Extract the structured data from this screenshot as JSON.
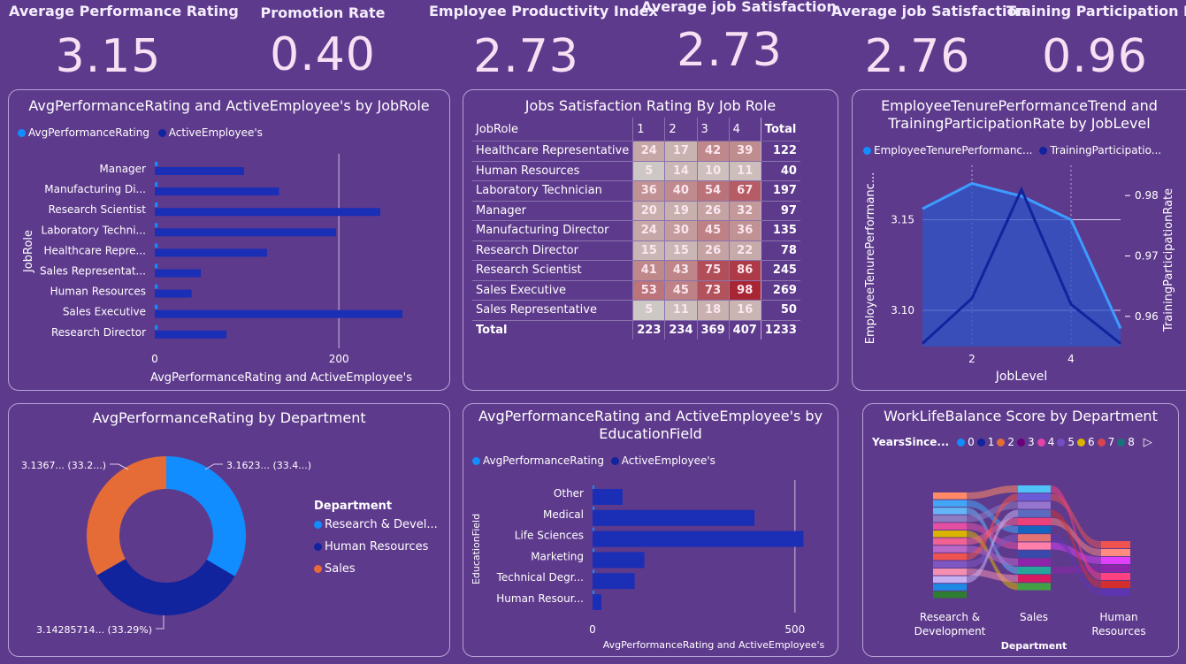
{
  "kpis": [
    {
      "label": "Average Performance Rating",
      "value": "3.15"
    },
    {
      "label": "Promotion Rate",
      "value": "0.40"
    },
    {
      "label": "Employee Productivity Index",
      "value": "2.73"
    },
    {
      "label": "Average job Satisfaction",
      "value": "2.73"
    },
    {
      "label": "Average job Satisfaction",
      "value": "2.76"
    },
    {
      "label": "Training Participation Ratio",
      "value": "0.96"
    }
  ],
  "colors": {
    "background": "#5e3a8c",
    "series_light": "#118dff",
    "series_dark": "#12239e",
    "orange": "#e66c37"
  },
  "jobrole_chart": {
    "title": "AvgPerformanceRating and ActiveEmployee's by JobRole",
    "legend": [
      "AvgPerformanceRating",
      "ActiveEmployee's"
    ],
    "ylabel": "JobRole",
    "xlabel": "AvgPerformanceRating and ActiveEmployee's",
    "ticks": [
      "0",
      "200"
    ]
  },
  "matrix": {
    "title": "Jobs Satisfaction Rating By Job Role",
    "headers": [
      "JobRole",
      "1",
      "2",
      "3",
      "4",
      "Total"
    ],
    "rows": [
      {
        "role": "Healthcare Representative",
        "v": [
          "24",
          "17",
          "42",
          "39"
        ],
        "total": "122"
      },
      {
        "role": "Human Resources",
        "v": [
          "5",
          "14",
          "10",
          "11"
        ],
        "total": "40"
      },
      {
        "role": "Laboratory Technician",
        "v": [
          "36",
          "40",
          "54",
          "67"
        ],
        "total": "197"
      },
      {
        "role": "Manager",
        "v": [
          "20",
          "19",
          "26",
          "32"
        ],
        "total": "97"
      },
      {
        "role": "Manufacturing Director",
        "v": [
          "24",
          "30",
          "45",
          "36"
        ],
        "total": "135"
      },
      {
        "role": "Research Director",
        "v": [
          "15",
          "15",
          "26",
          "22"
        ],
        "total": "78"
      },
      {
        "role": "Research Scientist",
        "v": [
          "41",
          "43",
          "75",
          "86"
        ],
        "total": "245"
      },
      {
        "role": "Sales Executive",
        "v": [
          "53",
          "45",
          "73",
          "98"
        ],
        "total": "269"
      },
      {
        "role": "Sales Representative",
        "v": [
          "5",
          "11",
          "18",
          "16"
        ],
        "total": "50"
      }
    ],
    "total_row": {
      "role": "Total",
      "v": [
        "223",
        "234",
        "369",
        "407"
      ],
      "total": "1233"
    }
  },
  "tenure_chart": {
    "title_line1": "EmployeeTenurePerformanceTrend and",
    "title_line2": "TrainingParticipationRate by JobLevel",
    "legend": [
      "EmployeeTenurePerformanc...",
      "TrainingParticipatio..."
    ],
    "ylabel_left": "EmployeeTenurePerformanc...",
    "ylabel_right": "TrainingParticipationRate",
    "xlabel": "JobLevel",
    "left_ticks": [
      "3.15",
      "3.10"
    ],
    "right_ticks": [
      "0.98",
      "0.97",
      "0.96"
    ],
    "x_ticks": [
      "2",
      "4"
    ]
  },
  "donut": {
    "title": "AvgPerformanceRating by Department",
    "legend_title": "Department",
    "labels": [
      "3.1367... (33.2...)",
      "3.1623... (33.4...)",
      "3.14285714... (33.29%)"
    ],
    "legend": [
      "Research & Devel...",
      "Human Resources",
      "Sales"
    ]
  },
  "edu_chart": {
    "title_line1": "AvgPerformanceRating and ActiveEmployee's by",
    "title_line2": "EducationField",
    "legend": [
      "AvgPerformanceRating",
      "ActiveEmployee's"
    ],
    "ylabel": "EducationField",
    "xlabel": "AvgPerformanceRating and ActiveEmployee's",
    "ticks": [
      "0",
      "500"
    ]
  },
  "wlb_chart": {
    "title": "WorkLifeBalance Score by Department",
    "legend_title": "YearsSince...",
    "legend": [
      "0",
      "1",
      "2",
      "3",
      "4",
      "5",
      "6",
      "7",
      "8"
    ],
    "legend_colors": [
      "#118dff",
      "#12239e",
      "#e66c37",
      "#6b007b",
      "#e044a7",
      "#744ec2",
      "#d9b300",
      "#d64550",
      "#197278"
    ],
    "departments": [
      "Research &",
      "Development",
      "Sales",
      "Human",
      "Resources"
    ],
    "xlabel": "Department"
  },
  "chart_data": [
    {
      "type": "bar",
      "title": "AvgPerformanceRating and ActiveEmployee's by JobRole",
      "categories": [
        "Manager",
        "Manufacturing Di...",
        "Research Scientist",
        "Laboratory Techni...",
        "Healthcare Repre...",
        "Sales Representat...",
        "Human Resources",
        "Sales Executive",
        "Research Director"
      ],
      "series": [
        {
          "name": "AvgPerformanceRating",
          "values": [
            3.2,
            3.1,
            3.2,
            3.1,
            3.2,
            3.1,
            3.2,
            3.1,
            3.2
          ]
        },
        {
          "name": "ActiveEmployee's",
          "values": [
            97,
            135,
            245,
            197,
            122,
            50,
            40,
            269,
            78
          ]
        }
      ],
      "xlabel": "AvgPerformanceRating and ActiveEmployee's",
      "ylabel": "JobRole",
      "xlim": [
        0,
        270
      ]
    },
    {
      "type": "line",
      "title": "EmployeeTenurePerformanceTrend and TrainingParticipationRate by JobLevel",
      "x": [
        1,
        2,
        3,
        4,
        5
      ],
      "series": [
        {
          "name": "EmployeeTenurePerformanc...",
          "axis": "left",
          "values": [
            3.156,
            3.17,
            3.163,
            3.15,
            3.09
          ]
        },
        {
          "name": "TrainingParticipatio...",
          "axis": "right",
          "values": [
            0.9555,
            0.963,
            0.981,
            0.962,
            0.9555
          ]
        }
      ],
      "xlabel": "JobLevel",
      "ylabel_left": "EmployeeTenurePerformanc...",
      "ylabel_right": "TrainingParticipationRate",
      "ylim_left": [
        3.08,
        3.18
      ],
      "ylim_right": [
        0.955,
        0.985
      ]
    },
    {
      "type": "pie",
      "title": "AvgPerformanceRating by Department",
      "categories": [
        "Research & Devel...",
        "Human Resources",
        "Sales"
      ],
      "values": [
        3.1623,
        3.14285714,
        3.1367
      ],
      "percent": [
        33.4,
        33.29,
        33.2
      ]
    },
    {
      "type": "bar",
      "title": "AvgPerformanceRating and ActiveEmployee's by EducationField",
      "categories": [
        "Other",
        "Medical",
        "Life Sciences",
        "Marketing",
        "Technical Degr...",
        "Human Resour..."
      ],
      "series": [
        {
          "name": "AvgPerformanceRating",
          "values": [
            3.2,
            3.1,
            3.2,
            3.1,
            3.2,
            3.1
          ]
        },
        {
          "name": "ActiveEmployee's",
          "values": [
            74,
            400,
            521,
            128,
            104,
            22
          ]
        }
      ],
      "xlabel": "AvgPerformanceRating and ActiveEmployee's",
      "ylabel": "EducationField",
      "xlim": [
        0,
        520
      ]
    }
  ]
}
